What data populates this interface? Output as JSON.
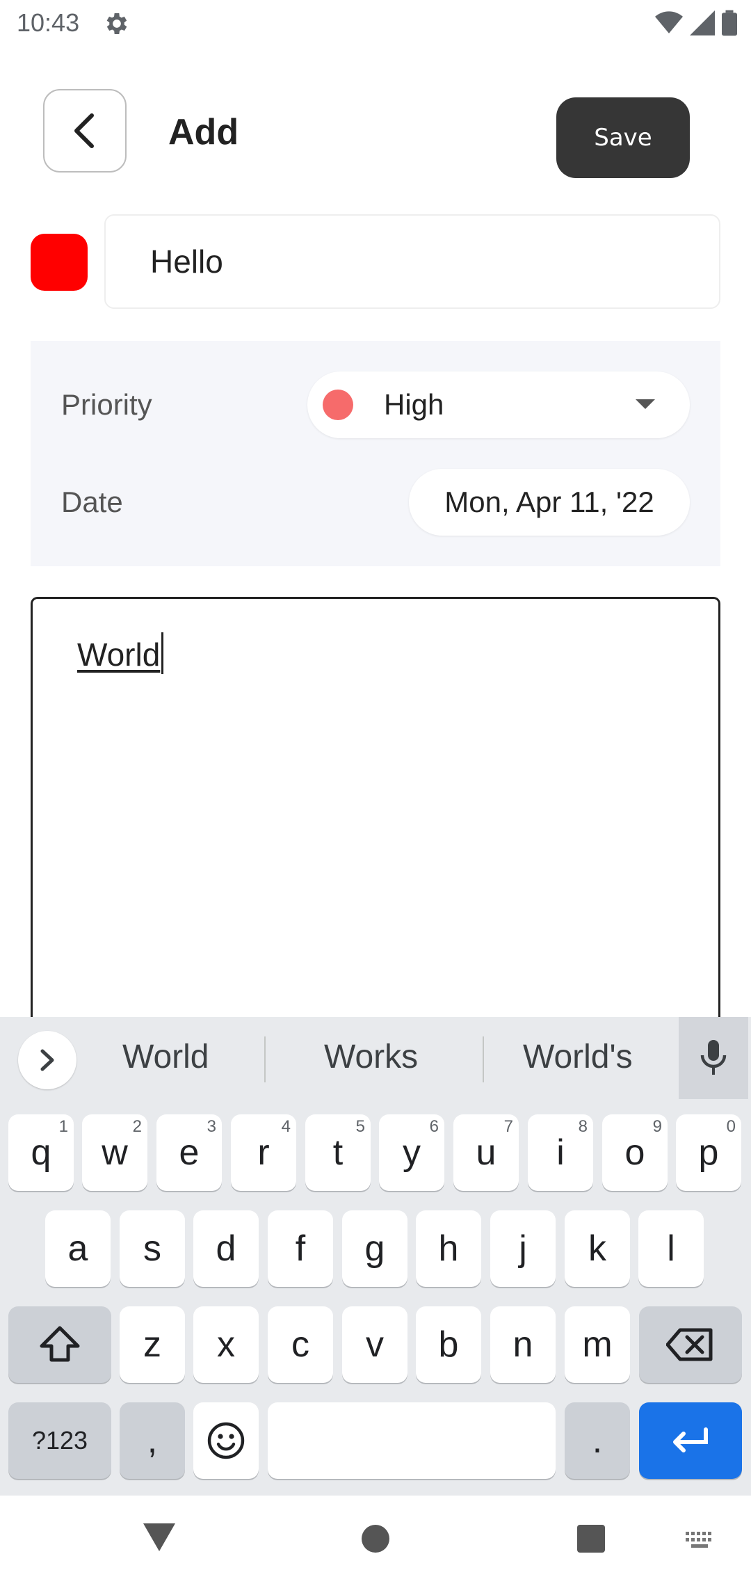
{
  "status_bar": {
    "time": "10:43"
  },
  "header": {
    "title": "Add",
    "save_label": "Save"
  },
  "task": {
    "color": "#ff0000",
    "title_value": "Hello",
    "priority_label": "Priority",
    "priority_value": "High",
    "priority_color": "#f66b6b",
    "date_label": "Date",
    "date_value": "Mon, Apr 11, '22",
    "description_value": "World"
  },
  "keyboard": {
    "suggestions": [
      "World",
      "Works",
      "World's"
    ],
    "row1": [
      {
        "key": "q",
        "hint": "1"
      },
      {
        "key": "w",
        "hint": "2"
      },
      {
        "key": "e",
        "hint": "3"
      },
      {
        "key": "r",
        "hint": "4"
      },
      {
        "key": "t",
        "hint": "5"
      },
      {
        "key": "y",
        "hint": "6"
      },
      {
        "key": "u",
        "hint": "7"
      },
      {
        "key": "i",
        "hint": "8"
      },
      {
        "key": "o",
        "hint": "9"
      },
      {
        "key": "p",
        "hint": "0"
      }
    ],
    "row2": [
      "a",
      "s",
      "d",
      "f",
      "g",
      "h",
      "j",
      "k",
      "l"
    ],
    "row3": [
      "z",
      "x",
      "c",
      "v",
      "b",
      "n",
      "m"
    ],
    "symbols_label": "?123",
    "comma_label": ",",
    "period_label": ".",
    "accent_color": "#1a73e8"
  }
}
